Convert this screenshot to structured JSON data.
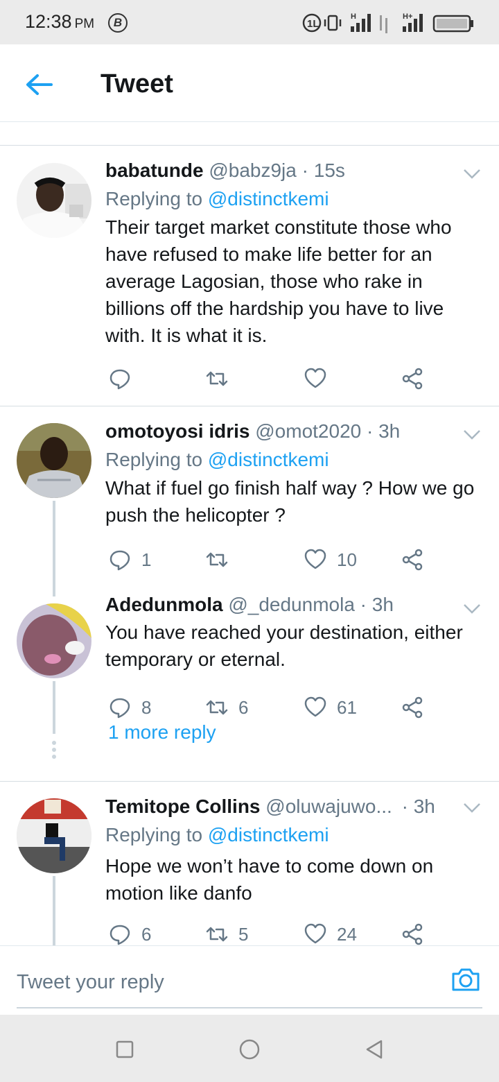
{
  "status_bar": {
    "time": "12:38",
    "ampm": "PM",
    "b_badge": "B",
    "icons": [
      "volte-icon",
      "vibrate-icon",
      "signal-icon",
      "data-arrows-icon",
      "signal-hplus-icon",
      "battery-icon"
    ]
  },
  "header": {
    "title": "Tweet",
    "back_icon": "arrow-left-icon",
    "accent": "#1da1f2"
  },
  "tweets": [
    {
      "name": "babatunde",
      "handle": "@babz9ja",
      "time": "15s",
      "replying_prefix": "Replying to",
      "replying_to": "@distinctkemi",
      "text": "Their target market constitute those who have refused to make life better for an average Lagosian, those who rake in billions off the hardship you have to live with. It is what it is.",
      "replies": "",
      "retweets": "",
      "likes": ""
    },
    {
      "name": "omotoyosi idris",
      "handle": "@omot2020",
      "time": "3h",
      "replying_prefix": "Replying to",
      "replying_to": "@distinctkemi",
      "text": "What if fuel go finish half way ? How we go push the helicopter ?",
      "replies": "1",
      "retweets": "",
      "likes": "10"
    },
    {
      "name": "Adedunmola",
      "handle": "@_dedunmola",
      "time": "3h",
      "text": "You have reached your destination, either temporary or eternal.",
      "replies": "8",
      "retweets": "6",
      "likes": "61"
    },
    {
      "name": "Temitope Collins",
      "handle": "@oluwajuwo...",
      "time": "3h",
      "replying_prefix": "Replying to",
      "replying_to": "@distinctkemi",
      "text": "Hope we won’t have to come down on motion like danfo",
      "replies": "6",
      "retweets": "5",
      "likes": "24"
    }
  ],
  "more_reply": "1 more reply",
  "composer": {
    "placeholder": "Tweet your reply",
    "camera_icon": "camera-icon"
  },
  "nav": [
    "square-icon",
    "circle-icon",
    "triangle-back-icon"
  ]
}
